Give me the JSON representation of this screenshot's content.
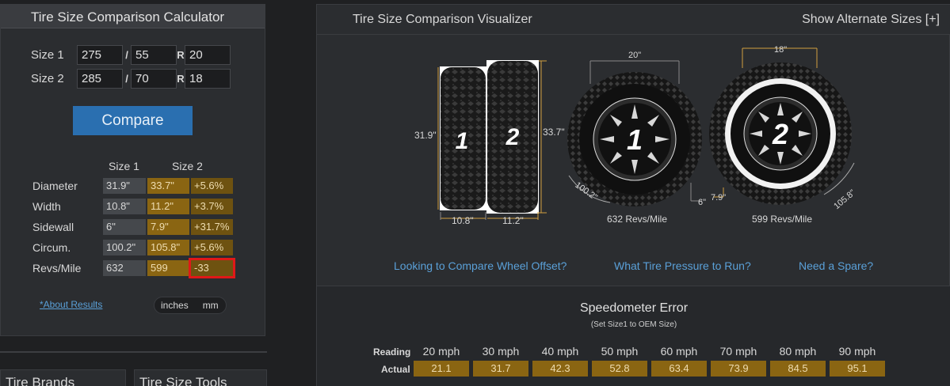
{
  "calculator": {
    "title": "Tire Size Comparison Calculator",
    "size1": {
      "label": "Size 1",
      "width": "275",
      "ratio": "55",
      "rim": "20"
    },
    "size2": {
      "label": "Size 2",
      "width": "285",
      "ratio": "70",
      "rim": "18"
    },
    "sep_slash": "/",
    "sep_r": "R",
    "compare_label": "Compare",
    "col_size1": "Size 1",
    "col_size2": "Size 2",
    "rows": [
      {
        "label": "Diameter",
        "s1": "31.9\"",
        "s2": "33.7\"",
        "diff": "+5.6%"
      },
      {
        "label": "Width",
        "s1": "10.8\"",
        "s2": "11.2\"",
        "diff": "+3.7%"
      },
      {
        "label": "Sidewall",
        "s1": "6\"",
        "s2": "7.9\"",
        "diff": "+31.7%"
      },
      {
        "label": "Circum.",
        "s1": "100.2\"",
        "s2": "105.8\"",
        "diff": "+5.6%"
      },
      {
        "label": "Revs/Mile",
        "s1": "632",
        "s2": "599",
        "diff": "-33"
      }
    ],
    "about_link": "*About Results",
    "units_inches": "inches",
    "units_mm": "mm"
  },
  "bottom_tabs": [
    "Tire Brands",
    "Tire Size Tools"
  ],
  "visualizer": {
    "title": "Tire Size Comparison Visualizer",
    "alt_sizes": "Show Alternate Sizes [+]",
    "side": {
      "tire1_num": "1",
      "tire2_num": "2",
      "height1": "31.9\"",
      "height2": "33.7\"",
      "width1": "10.8\"",
      "width2": "11.2\""
    },
    "wheel1": {
      "num": "1",
      "rim": "20\"",
      "circ": "100.2\"",
      "sidewall": "6\"",
      "revs": "632 Revs/Mile"
    },
    "wheel2": {
      "num": "2",
      "rim": "18\"",
      "circ": "105.8\"",
      "sidewall": "7.9\"",
      "revs": "599 Revs/Mile"
    },
    "links": [
      "Looking to Compare Wheel Offset?",
      "What Tire Pressure to Run?",
      "Need a Spare?"
    ],
    "speedometer": {
      "title": "Speedometer Error",
      "subtitle": "(Set Size1 to OEM Size)",
      "reading_label": "Reading",
      "actual_label": "Actual",
      "readings": [
        "20 mph",
        "30 mph",
        "40 mph",
        "50 mph",
        "60 mph",
        "70 mph",
        "80 mph",
        "90 mph"
      ],
      "actuals": [
        "21.1",
        "31.7",
        "42.3",
        "52.8",
        "63.4",
        "73.9",
        "84.5",
        "95.1"
      ]
    }
  },
  "colors": {
    "accent_gold": "#8a6512",
    "button_blue": "#2a6fb0",
    "link_blue": "#5aa0d8",
    "highlight_red": "#e01818"
  }
}
